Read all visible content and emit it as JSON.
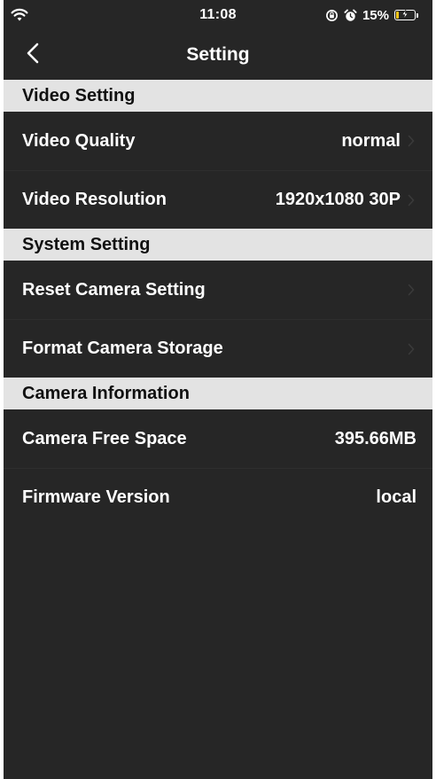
{
  "status_bar": {
    "time": "11:08",
    "battery_percent_label": "15%",
    "battery_level": 0.15,
    "icons": [
      "wifi-icon",
      "rotation-lock-icon",
      "alarm-icon",
      "battery-charging-icon"
    ]
  },
  "nav": {
    "title": "Setting",
    "back_icon": "chevron-left-icon"
  },
  "sections": [
    {
      "header": "Video Setting",
      "rows": [
        {
          "label": "Video Quality",
          "value": "normal",
          "chevron": true
        },
        {
          "label": "Video Resolution",
          "value": "1920x1080 30P",
          "chevron": true
        }
      ]
    },
    {
      "header": "System Setting",
      "rows": [
        {
          "label": "Reset Camera Setting",
          "value": "",
          "chevron": true
        },
        {
          "label": "Format Camera Storage",
          "value": "",
          "chevron": true
        }
      ]
    },
    {
      "header": "Camera Information",
      "rows": [
        {
          "label": "Camera Free Space",
          "value": "395.66MB",
          "chevron": false
        },
        {
          "label": "Firmware Version",
          "value": "local",
          "chevron": false
        }
      ]
    }
  ],
  "colors": {
    "background": "#262626",
    "section_header_bg": "#e3e3e3",
    "section_header_text": "#111111",
    "text": "#ffffff",
    "chevron": "#3a3a3a",
    "battery_fill": "#f5c518"
  }
}
